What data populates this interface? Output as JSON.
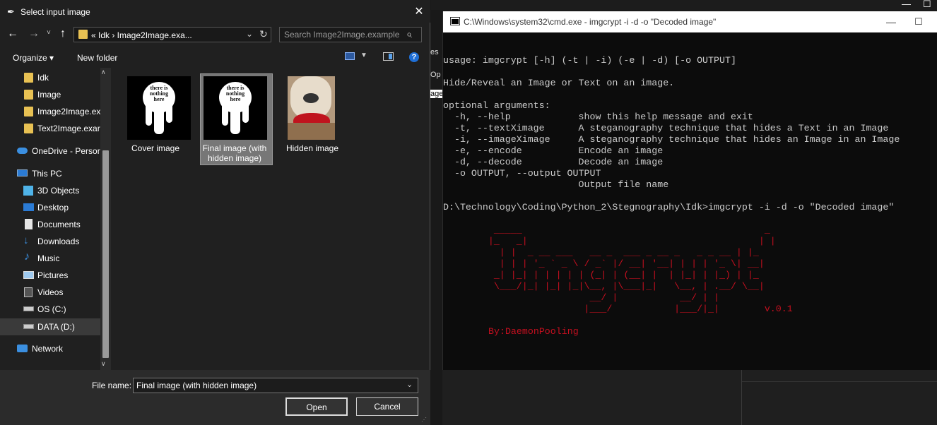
{
  "background": {
    "fragments": [
      "es",
      "Op",
      "age"
    ],
    "window_buttons": [
      "—",
      "☐"
    ]
  },
  "terminal": {
    "title": "C:\\Windows\\system32\\cmd.exe - imgcrypt  -i -d -o \"Decoded image\"",
    "controls": {
      "minimize": "—",
      "maximize": "☐"
    },
    "lines": [
      "usage: imgcrypt [-h] (-t | -i) (-e | -d) [-o OUTPUT]",
      "",
      "Hide/Reveal an Image or Text on an image.",
      "",
      "optional arguments:",
      "  -h, --help            show this help message and exit",
      "  -t, --textXimage      A steganography technique that hides a Text in an Image",
      "  -i, --imageXimage     A steganography technique that hides an Image in an Image",
      "  -e, --encode          Encode an image",
      "  -d, --decode          Decode an image",
      "  -o OUTPUT, --output OUTPUT",
      "                        Output file name",
      "",
      "D:\\Technology\\Coding\\Python_2\\Stegnography\\Idk>imgcrypt -i -d -o \"Decoded image\""
    ],
    "ascii_art": [
      "         _____                                           _",
      "        |_   _|                                         | |",
      "          | |  _ __ ___   __ _  ___ _ __ _   _ _ __ | |_",
      "          | | | '_ ` _ \\ / _` |/ __| '__| | | | '_ \\| __|",
      "         _| |_| | | | | | (_| | (__| |  | |_| | |_) | |_",
      "         \\___/|_| |_| |_|\\__, |\\___|_|   \\__, | .__/ \\__|",
      "                          __/ |           __/ | |",
      "                         |___/           |___/|_|        v.0.1"
    ],
    "author": "By:DaemonPooling"
  },
  "dialog": {
    "title": "Select input image",
    "close": "✕",
    "nav": {
      "back": "←",
      "forward": "→",
      "recent": "˅",
      "up": "↑"
    },
    "address": "«  Idk  ›  Image2Image.exa...",
    "search_placeholder": "Search Image2Image.example",
    "toolbar": {
      "organize": "Organize ▾",
      "new_folder": "New folder",
      "help": "?"
    },
    "sidebar": {
      "items": [
        {
          "label": "Idk",
          "icon": "folder-icon"
        },
        {
          "label": "Image",
          "icon": "folder-icon"
        },
        {
          "label": "Image2Image.ex",
          "icon": "folder-icon"
        },
        {
          "label": "Text2Image.exar",
          "icon": "folder-icon"
        },
        {
          "label": "OneDrive - Persor",
          "icon": "cloud-icon"
        },
        {
          "label": "This PC",
          "icon": "computer-icon"
        },
        {
          "label": "3D Objects",
          "icon": "cube-icon"
        },
        {
          "label": "Desktop",
          "icon": "desktop-icon"
        },
        {
          "label": "Documents",
          "icon": "document-icon"
        },
        {
          "label": "Downloads",
          "icon": "download-icon"
        },
        {
          "label": "Music",
          "icon": "music-icon"
        },
        {
          "label": "Pictures",
          "icon": "picture-icon"
        },
        {
          "label": "Videos",
          "icon": "video-icon"
        },
        {
          "label": "OS (C:)",
          "icon": "drive-icon"
        },
        {
          "label": "DATA (D:)",
          "icon": "drive-icon"
        },
        {
          "label": "Network",
          "icon": "network-icon"
        }
      ]
    },
    "files": [
      {
        "name": "Cover image",
        "thumb_text": "there is nothing here"
      },
      {
        "name": "Final image (with hidden image)",
        "thumb_text": "there is nothing here"
      },
      {
        "name": "Hidden image"
      }
    ],
    "file_name_label": "File name:",
    "file_name_value": "Final image (with hidden image)",
    "open_label": "Open",
    "cancel_label": "Cancel"
  },
  "colors": {
    "accent": "#1f6fd6",
    "folder": "#e8c153",
    "terminal_art": "#c50f1f"
  }
}
